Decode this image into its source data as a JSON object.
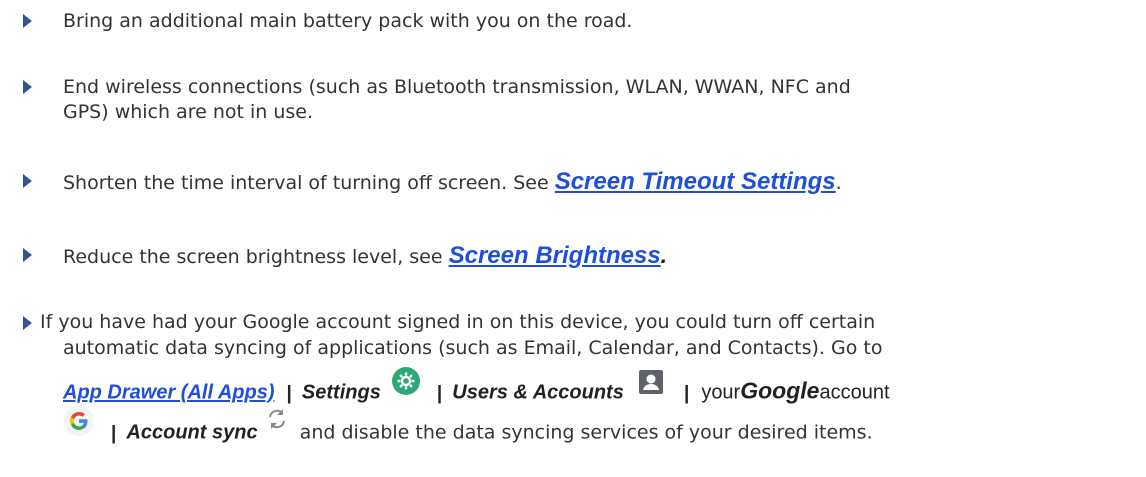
{
  "bullets": [
    {
      "text": "Bring an additional main battery pack with you on the road."
    },
    {
      "line1": "End wireless connections (such as Bluetooth transmission, WLAN, WWAN, NFC and",
      "line2": "GPS) which are not in use."
    },
    {
      "before": "Shorten the time interval of turning off screen. See ",
      "link": "Screen Timeout Settings",
      "after": "."
    },
    {
      "before": "Reduce the screen brightness level, see ",
      "link": "Screen Brightness",
      "after": "."
    },
    {
      "line1": "If you have had your Google account signed in on this device, you could turn off certain",
      "line2": "automatic data syncing of applications (such as Email, Calendar, and Contacts). Go to",
      "app_drawer_link": "App Drawer (All Apps)",
      "sep": "|",
      "settings": "Settings",
      "users_accounts": "Users & Accounts",
      "your": "your",
      "google": "Google",
      "account": "account",
      "account_sync": "Account sync",
      "tail": "and disable the data syncing services of your desired items."
    }
  ],
  "icons": {
    "bullet": "triangle-right-icon",
    "settings": "settings-gear-icon",
    "account": "account-person-icon",
    "google": "google-g-icon",
    "sync": "sync-icon"
  },
  "colors": {
    "link": "#1f4fd8",
    "bullet": "#2f5597",
    "text": "#333333",
    "settings_icon": "#2aa876"
  }
}
